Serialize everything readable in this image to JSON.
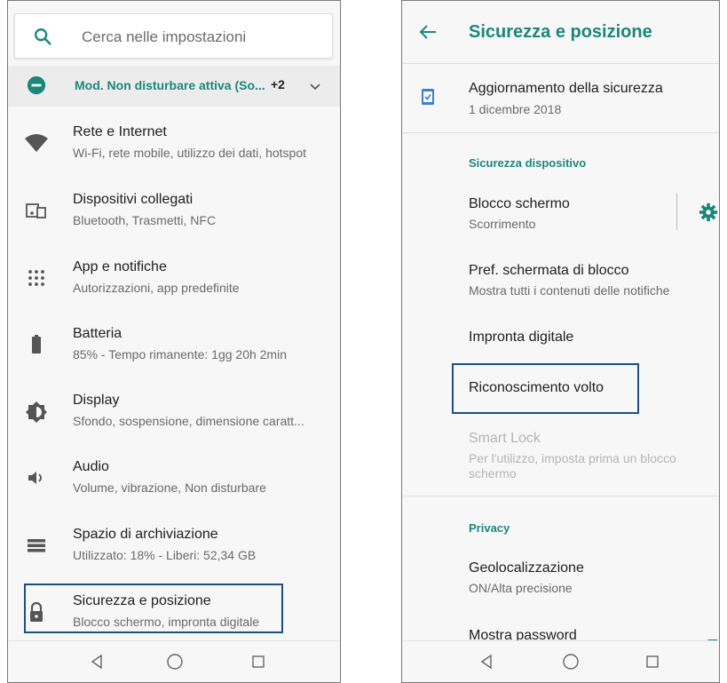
{
  "left": {
    "search_placeholder": "Cerca nelle impostazioni",
    "dnd": {
      "label": "Mod. Non disturbare attiva (So...",
      "count": "+2"
    },
    "items": [
      {
        "title": "Rete e Internet",
        "subtitle": "Wi-Fi, rete mobile, utilizzo dei dati, hotspot",
        "icon": "wifi-icon"
      },
      {
        "title": "Dispositivi collegati",
        "subtitle": "Bluetooth, Trasmetti, NFC",
        "icon": "devices-icon"
      },
      {
        "title": "App e notifiche",
        "subtitle": "Autorizzazioni, app predefinite",
        "icon": "apps-icon"
      },
      {
        "title": "Batteria",
        "subtitle": "85% - Tempo rimanente: 1gg 20h 2min",
        "icon": "battery-icon"
      },
      {
        "title": "Display",
        "subtitle": "Sfondo, sospensione, dimensione caratt...",
        "icon": "brightness-icon"
      },
      {
        "title": "Audio",
        "subtitle": "Volume, vibrazione, Non disturbare",
        "icon": "volume-icon"
      },
      {
        "title": "Spazio di archiviazione",
        "subtitle": "Utilizzato: 18% - Liberi: 52,34 GB",
        "icon": "storage-icon"
      },
      {
        "title": "Sicurezza e posizione",
        "subtitle": "Blocco schermo, impronta digitale",
        "icon": "lock-icon"
      }
    ]
  },
  "right": {
    "title": "Sicurezza e posizione",
    "security_update": {
      "title": "Aggiornamento della sicurezza",
      "subtitle": "1 dicembre 2018"
    },
    "section_device": "Sicurezza dispositivo",
    "screen_lock": {
      "title": "Blocco schermo",
      "subtitle": "Scorrimento"
    },
    "lock_prefs": {
      "title": "Pref. schermata di blocco",
      "subtitle": "Mostra tutti i contenuti delle notifiche"
    },
    "fingerprint": {
      "title": "Impronta digitale"
    },
    "face": {
      "title": "Riconoscimento volto"
    },
    "smart_lock": {
      "title": "Smart Lock",
      "subtitle_line1": "Per l'utilizzo, imposta prima un blocco",
      "subtitle_line2": "schermo"
    },
    "section_privacy": "Privacy",
    "location": {
      "title": "Geolocalizzazione",
      "subtitle": "ON/Alta precisione"
    },
    "show_password": {
      "title": "Mostra password"
    }
  },
  "colors": {
    "accent": "#1b877a",
    "selection_border": "#1c4e86"
  }
}
